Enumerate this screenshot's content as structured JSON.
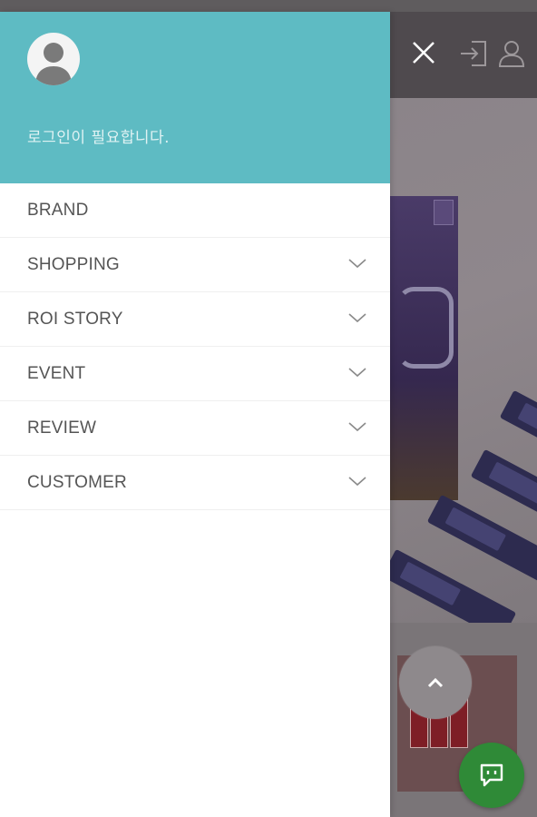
{
  "drawer": {
    "login_message": "로그인이 필요합니다.",
    "menu": [
      {
        "label": "BRAND",
        "expandable": false
      },
      {
        "label": "SHOPPING",
        "expandable": true
      },
      {
        "label": "ROI STORY",
        "expandable": true
      },
      {
        "label": "EVENT",
        "expandable": true
      },
      {
        "label": "REVIEW",
        "expandable": true
      },
      {
        "label": "CUSTOMER",
        "expandable": true
      }
    ]
  },
  "header_icons": [
    "close-icon",
    "login-icon",
    "user-icon"
  ],
  "floating": {
    "scroll_top_icon": "chevron-up-icon",
    "chat_icon": "chat-icon"
  },
  "colors": {
    "drawer_header": "#5ebbc3",
    "chat_button": "#2f8a37",
    "menu_text": "#555555"
  }
}
